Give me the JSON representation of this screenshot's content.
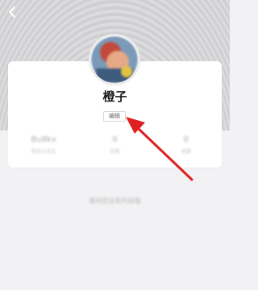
{
  "header": {
    "back_icon": "chevron-left-icon"
  },
  "profile": {
    "name": "橙子",
    "edit_label": "编辑"
  },
  "stats": [
    {
      "value": "Bu8kv",
      "label": "粉丝与关注"
    },
    {
      "value": "0",
      "label": "获赞"
    },
    {
      "value": "0",
      "label": "收藏"
    }
  ],
  "empty_state": "暂时还没有内容哦",
  "annotation": {
    "arrow_color": "#e02020"
  }
}
